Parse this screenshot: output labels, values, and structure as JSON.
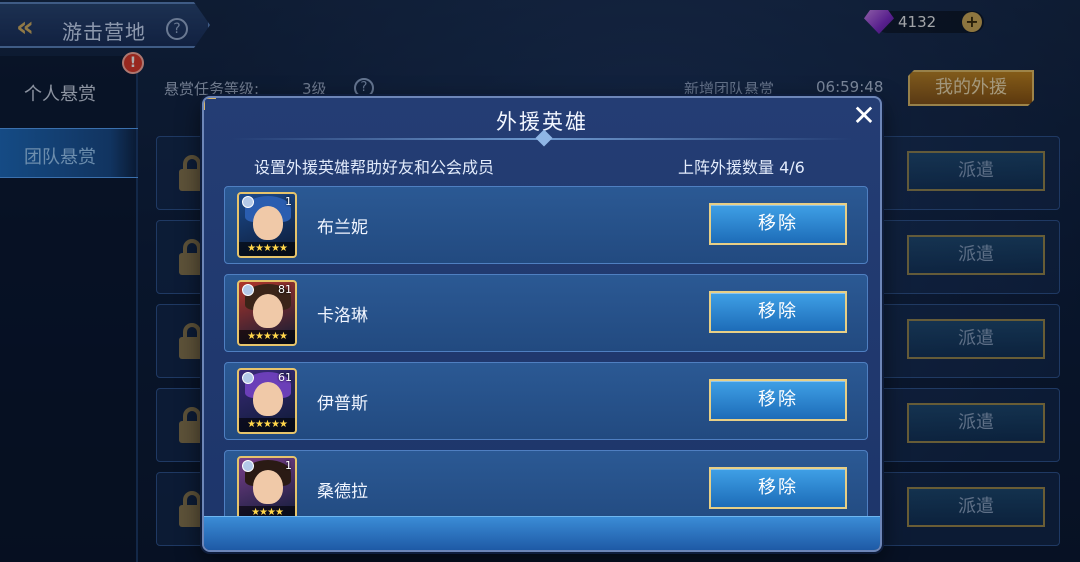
{
  "topbar": {
    "title": "游击营地",
    "back_icon": "back-chevron-icon",
    "help_glyph": "?",
    "gems": "4132",
    "gem_icon": "purple-gem-icon",
    "plus_glyph": "+"
  },
  "sidebar": {
    "items": [
      {
        "label": "个人悬赏",
        "active": false
      },
      {
        "label": "团队悬赏",
        "active": true
      }
    ],
    "alert_glyph": "!"
  },
  "info": {
    "tier_label": "悬赏任务等级:",
    "tier_value": "3级",
    "help_glyph": "?",
    "new_bounty_label": "新增团队悬赏",
    "timer": "06:59:48",
    "my_aid_button": "我的外援"
  },
  "bounties": {
    "dispatch_label": "派遣",
    "rows": 5
  },
  "modal": {
    "title": "外援英雄",
    "close_glyph": "✕",
    "subtitle": "设置外援英雄帮助好友和公会成员",
    "count_label": "上阵外援数量 4/6",
    "remove_label": "移除",
    "heroes": [
      {
        "name": "布兰妮",
        "level": "1",
        "stars": "★★★★★",
        "hair": "#2a5db0",
        "bg": "#1b4a8c"
      },
      {
        "name": "卡洛琳",
        "level": "81",
        "stars": "★★★★★",
        "hair": "#3a2418",
        "bg": "#b0352a"
      },
      {
        "name": "伊普斯",
        "level": "61",
        "stars": "★★★★★",
        "hair": "#6b3fb8",
        "bg": "#3a2a78"
      },
      {
        "name": "桑德拉",
        "level": "1",
        "stars": "★★★★",
        "hair": "#2a1a14",
        "bg": "#7a3f8a"
      }
    ]
  },
  "colors": {
    "accent_gold": "#d6b46a",
    "button_blue": "#1d6cb8",
    "panel": "#243d74"
  }
}
